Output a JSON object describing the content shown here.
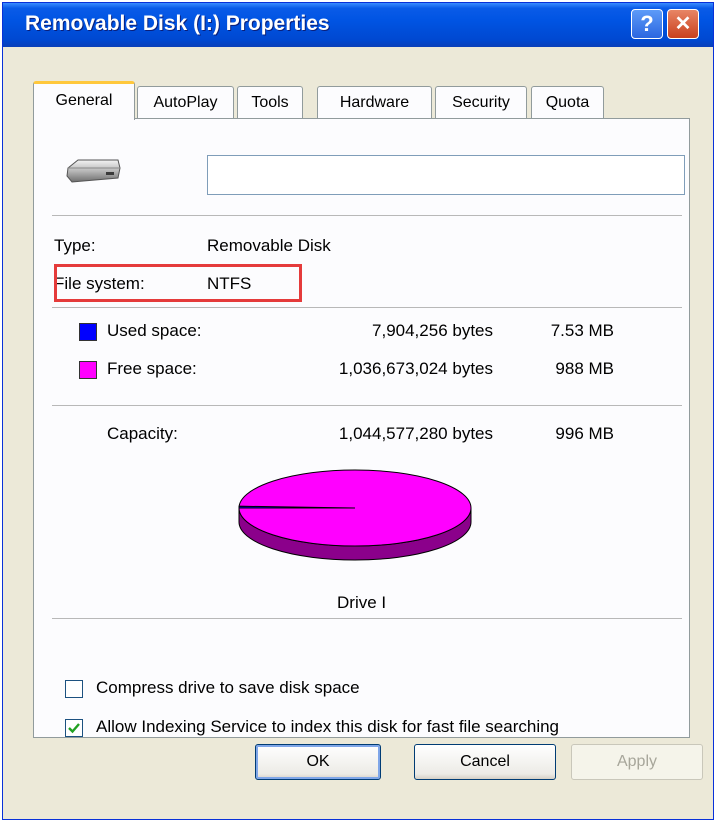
{
  "window": {
    "title": "Removable Disk (I:) Properties",
    "help_glyph": "?",
    "close_glyph": "✕"
  },
  "tabs": [
    {
      "label": "General",
      "active": true
    },
    {
      "label": "AutoPlay"
    },
    {
      "label": "Tools"
    },
    {
      "label": "Hardware"
    },
    {
      "label": "Security"
    },
    {
      "label": "Quota"
    }
  ],
  "general": {
    "volume_label_value": "",
    "type_label": "Type:",
    "type_value": "Removable Disk",
    "fs_label": "File system:",
    "fs_value": "NTFS",
    "used": {
      "label": "Used space:",
      "bytes": "7,904,256 bytes",
      "size": "7.53 MB",
      "color": "#0000FF"
    },
    "free": {
      "label": "Free space:",
      "bytes": "1,036,673,024 bytes",
      "size": "988 MB",
      "color": "#FF00FF"
    },
    "capacity": {
      "label": "Capacity:",
      "bytes": "1,044,577,280 bytes",
      "size": "996 MB"
    },
    "drive_label": "Drive I",
    "compress": {
      "label": "Compress drive to save disk space",
      "checked": false
    },
    "indexing": {
      "label": "Allow Indexing Service to index this disk for fast file searching",
      "checked": true
    }
  },
  "chart_data": {
    "type": "pie",
    "categories": [
      "Used space",
      "Free space"
    ],
    "values": [
      7904256,
      1036673024
    ],
    "colors": [
      "#0000FF",
      "#FF00FF"
    ]
  },
  "buttons": {
    "ok": "OK",
    "cancel": "Cancel",
    "apply": "Apply"
  }
}
